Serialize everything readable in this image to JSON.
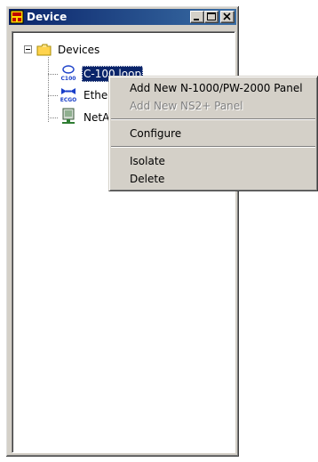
{
  "window": {
    "title": "Device"
  },
  "tree": {
    "root": {
      "label": "Devices"
    },
    "items": [
      {
        "label": "C-100 loop",
        "icon": "c100-loop-icon",
        "icon_text": "C100",
        "selected": true
      },
      {
        "label": "Ether",
        "icon": "ecgo-ethernet-icon",
        "icon_text": "ECGO",
        "selected": false
      },
      {
        "label": "NetA",
        "icon": "netaccess-device-icon",
        "selected": false
      }
    ]
  },
  "context_menu": {
    "items": [
      {
        "label": "Add New N-1000/PW-2000 Panel",
        "enabled": true
      },
      {
        "label": "Add New NS2+ Panel",
        "enabled": false
      },
      {
        "label": "Configure",
        "enabled": true
      },
      {
        "label": "Isolate",
        "enabled": true
      },
      {
        "label": "Delete",
        "enabled": true
      }
    ]
  },
  "colors": {
    "title_bar": "#0a246a",
    "selection": "#0a246a",
    "face": "#d4d0c8"
  }
}
